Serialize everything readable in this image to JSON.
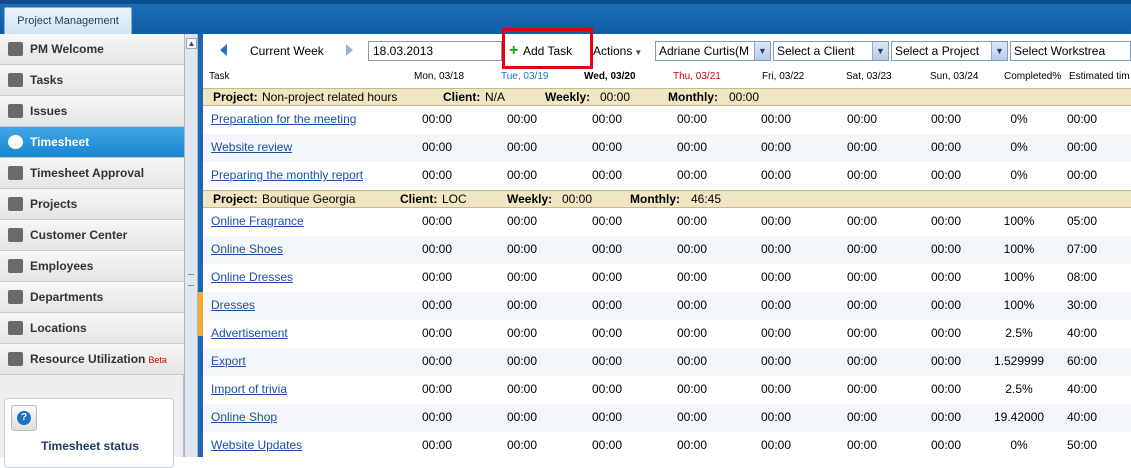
{
  "app": {
    "tab_label": "Project Management"
  },
  "sidebar": {
    "items": [
      {
        "label": "PM Welcome",
        "icon": "grid-icon"
      },
      {
        "label": "Tasks",
        "icon": "list-icon"
      },
      {
        "label": "Issues",
        "icon": "list-icon"
      },
      {
        "label": "Timesheet",
        "icon": "clock-icon",
        "active": true
      },
      {
        "label": "Timesheet Approval",
        "icon": "check-clock-icon"
      },
      {
        "label": "Projects",
        "icon": "folder-icon"
      },
      {
        "label": "Customer Center",
        "icon": "building-icon"
      },
      {
        "label": "Employees",
        "icon": "person-icon"
      },
      {
        "label": "Departments",
        "icon": "cube-icon"
      },
      {
        "label": "Locations",
        "icon": "flag-icon"
      },
      {
        "label": "Resource Utilization",
        "icon": "person-chart-icon",
        "badge": "Beta"
      }
    ],
    "help": {
      "title": "Timesheet status"
    }
  },
  "toolbar": {
    "current_week": "Current Week",
    "date": "18.03.2013",
    "add_task": "Add Task",
    "actions": "Actions",
    "employee": "Adriane Curtis(M",
    "client": "Select a Client",
    "project": "Select a Project",
    "workstream": "Select Workstrea"
  },
  "grid": {
    "columns": [
      "Task",
      "Mon, 03/18",
      "Tue, 03/19",
      "Wed, 03/20",
      "Thu, 03/21",
      "Fri, 03/22",
      "Sat, 03/23",
      "Sun, 03/24",
      "Completed%",
      "Estimated tim"
    ],
    "column_colors": {
      "today": "#1a76c9",
      "holiday": "#d40000"
    },
    "groups": [
      {
        "project_label": "Project:",
        "project": "Non-project related hours",
        "client_label": "Client:",
        "client": "N/A",
        "weekly_label": "Weekly:",
        "weekly": "00:00",
        "monthly_label": "Monthly:",
        "monthly": "00:00",
        "rows": [
          {
            "task": "Preparation for the meeting",
            "hours": [
              "00:00",
              "00:00",
              "00:00",
              "00:00",
              "00:00",
              "00:00",
              "00:00"
            ],
            "completed": "0%",
            "estimated": "00:00"
          },
          {
            "task": "Website review",
            "hours": [
              "00:00",
              "00:00",
              "00:00",
              "00:00",
              "00:00",
              "00:00",
              "00:00"
            ],
            "completed": "0%",
            "estimated": "00:00"
          },
          {
            "task": "Preparing the monthly report",
            "hours": [
              "00:00",
              "00:00",
              "00:00",
              "00:00",
              "00:00",
              "00:00",
              "00:00"
            ],
            "completed": "0%",
            "estimated": "00:00"
          }
        ]
      },
      {
        "project_label": "Project:",
        "project": "Boutique Georgia",
        "client_label": "Client:",
        "client": "LOC",
        "weekly_label": "Weekly:",
        "weekly": "00:00",
        "monthly_label": "Monthly:",
        "monthly": "46:45",
        "rows": [
          {
            "task": "Online Fragrance",
            "hours": [
              "00:00",
              "00:00",
              "00:00",
              "00:00",
              "00:00",
              "00:00",
              "00:00"
            ],
            "completed": "100%",
            "estimated": "05:00"
          },
          {
            "task": "Online Shoes",
            "hours": [
              "00:00",
              "00:00",
              "00:00",
              "00:00",
              "00:00",
              "00:00",
              "00:00"
            ],
            "completed": "100%",
            "estimated": "07:00"
          },
          {
            "task": "Online Dresses",
            "hours": [
              "00:00",
              "00:00",
              "00:00",
              "00:00",
              "00:00",
              "00:00",
              "00:00"
            ],
            "completed": "100%",
            "estimated": "08:00"
          },
          {
            "task": "Dresses",
            "hours": [
              "00:00",
              "00:00",
              "00:00",
              "00:00",
              "00:00",
              "00:00",
              "00:00"
            ],
            "completed": "100%",
            "estimated": "30:00"
          },
          {
            "task": "Advertisement",
            "hours": [
              "00:00",
              "00:00",
              "00:00",
              "00:00",
              "00:00",
              "00:00",
              "00:00"
            ],
            "completed": "2.5%",
            "estimated": "40:00"
          },
          {
            "task": "Export",
            "hours": [
              "00:00",
              "00:00",
              "00:00",
              "00:00",
              "00:00",
              "00:00",
              "00:00"
            ],
            "completed": "1.529999",
            "estimated": "60:00"
          },
          {
            "task": "Import of trivia",
            "hours": [
              "00:00",
              "00:00",
              "00:00",
              "00:00",
              "00:00",
              "00:00",
              "00:00"
            ],
            "completed": "2.5%",
            "estimated": "40:00"
          },
          {
            "task": "Online Shop",
            "hours": [
              "00:00",
              "00:00",
              "00:00",
              "00:00",
              "00:00",
              "00:00",
              "00:00"
            ],
            "completed": "19.42000",
            "estimated": "40:00"
          },
          {
            "task": "Website Updates",
            "hours": [
              "00:00",
              "00:00",
              "00:00",
              "00:00",
              "00:00",
              "00:00",
              "00:00"
            ],
            "completed": "0%",
            "estimated": "50:00"
          }
        ]
      }
    ]
  }
}
